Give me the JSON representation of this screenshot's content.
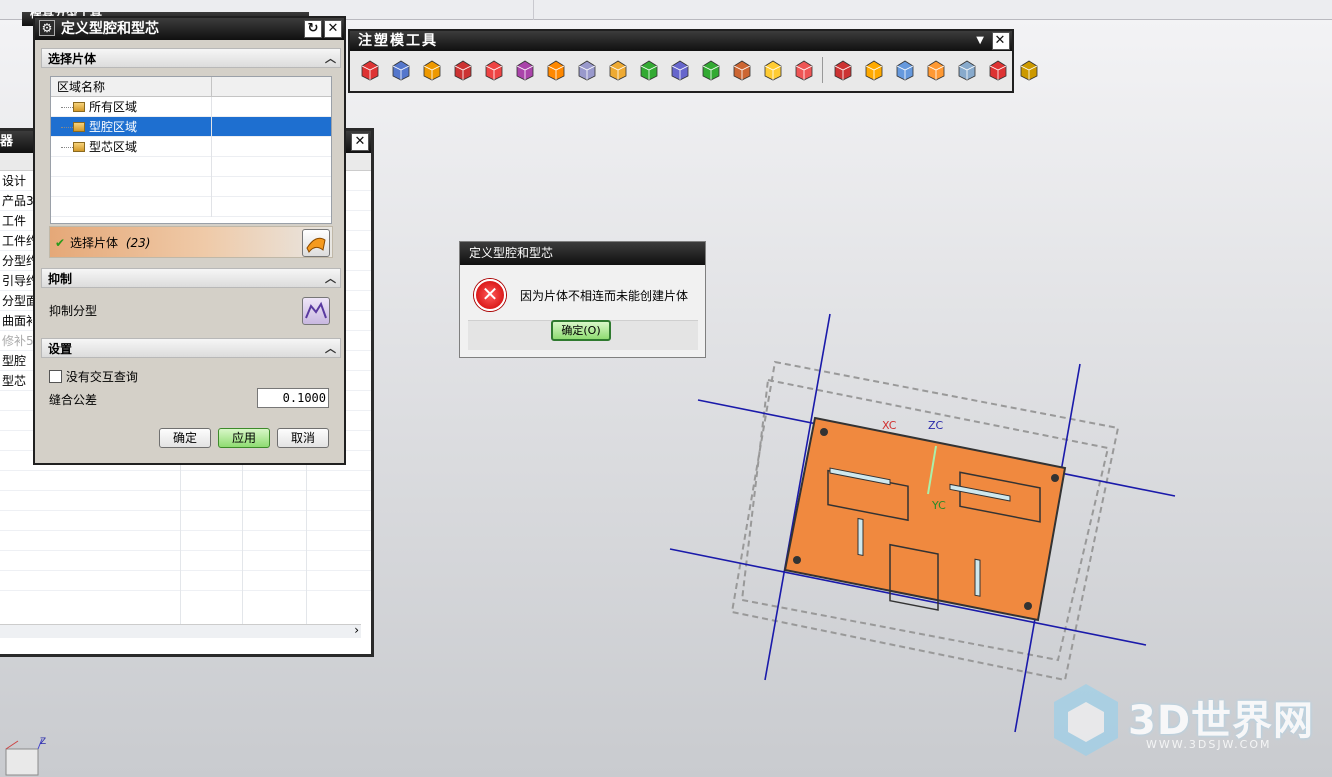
{
  "top_strip": {
    "menu_partial": "模具分型工具"
  },
  "navigator": {
    "title_fragment": "器",
    "tree_items": [
      "设计",
      "产品3",
      "工件",
      "工件约",
      "分型约",
      "引导约",
      "分型面",
      "曲面补",
      "修补5",
      "型腔",
      "型芯"
    ]
  },
  "define_dialog": {
    "title": "定义型腔和型芯",
    "section_select_sheet": "选择片体",
    "table_header": "区域名称",
    "regions": [
      "所有区域",
      "型腔区域",
      "型芯区域"
    ],
    "selected_region_index": 1,
    "select_sheet_label": "选择片体",
    "select_sheet_count": "(23)",
    "section_suppress": "抑制",
    "suppress_label": "抑制分型",
    "section_settings": "设置",
    "no_interaction_label": "没有交互查询",
    "no_interaction_checked": false,
    "stitch_tolerance_label": "缝合公差",
    "stitch_tolerance_value": "0.1000",
    "ok_label": "确定",
    "apply_label": "应用",
    "cancel_label": "取消"
  },
  "mold_tools": {
    "title": "注塑模工具",
    "icons": [
      "create-box-icon",
      "split-solid-icon",
      "solid-patch-icon",
      "sheet-patch-icon",
      "edge-patch-icon",
      "extend-sheet-icon",
      "bounded-plane-icon",
      "trim-region-icon",
      "replace-face-icon",
      "extension-sheet-icon",
      "line-split-icon",
      "reference-circle-icon",
      "split-face-icon",
      "extend-solid-icon",
      "offset-region-icon",
      "wcs-icon",
      "suppress-icon",
      "merge-cavity-icon",
      "trim-solid-icon",
      "face-color-icon",
      "mold-design-check-icon",
      "reference-ruler-icon"
    ]
  },
  "error_dialog": {
    "title": "定义型腔和型芯",
    "message": "因为片体不相连而未能创建片体",
    "ok_label": "确定(O)"
  },
  "viewport": {
    "axis_labels": {
      "xc": "XC",
      "zc": "ZC",
      "yc": "YC"
    },
    "triad_label": "Z",
    "part_color": "#f0893f"
  },
  "watermark": {
    "brand": "3D世界网",
    "url": "WWW.3DSJW.COM"
  }
}
